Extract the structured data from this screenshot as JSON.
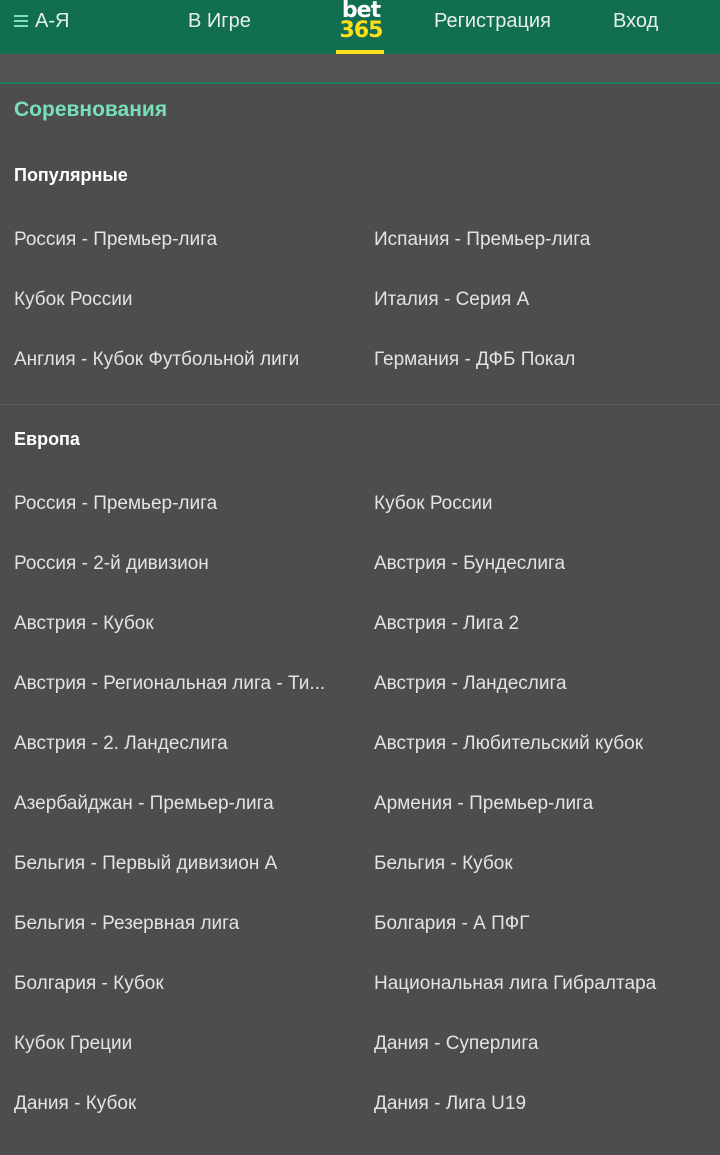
{
  "header": {
    "az_label": "А-Я",
    "inplay_label": "В Игре",
    "logo_top": "bet",
    "logo_bottom": "365",
    "register_label": "Регистрация",
    "login_label": "Вход"
  },
  "page": {
    "title": "Соревнования"
  },
  "popular": {
    "title": "Популярные",
    "left": [
      "Россия - Премьер-лига",
      "Кубок России",
      "Англия - Кубок Футбольной лиги"
    ],
    "right": [
      "Испания - Премьер-лига",
      "Италия - Серия А",
      "Германия - ДФБ Покал"
    ]
  },
  "europe": {
    "title": "Европа",
    "left": [
      "Россия - Премьер-лига",
      "Россия - 2-й дивизион",
      "Австрия - Кубок",
      "Австрия - Региональная лига - Ти...",
      "Австрия - 2. Ландеслига",
      "Азербайджан - Премьер-лига",
      "Бельгия - Первый дивизион А",
      "Бельгия - Резервная лига",
      "Болгария - Кубок",
      "Кубок Греции",
      "Дания - Кубок"
    ],
    "right": [
      "Кубок России",
      "Австрия - Бундеслига",
      "Австрия - Лига 2",
      "Австрия - Ландеслига",
      "Австрия - Любительский кубок",
      "Армения - Премьер-лига",
      "Бельгия - Кубок",
      "Болгария - А ПФГ",
      "Национальная лига Гибралтара",
      "Дания - Суперлига",
      "Дания - Лига U19"
    ]
  },
  "colors": {
    "header_bg": "#126e51",
    "accent_green": "#78e0b8",
    "logo_yellow": "#ffdf1b",
    "page_bg": "#4d4d4d"
  }
}
